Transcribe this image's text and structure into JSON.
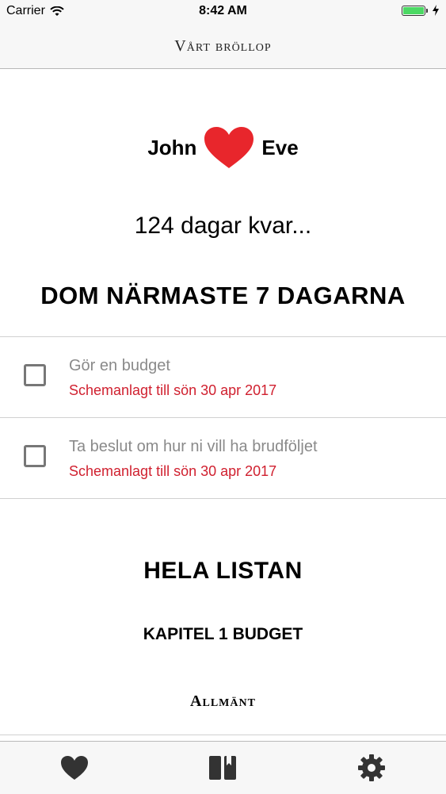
{
  "status_bar": {
    "carrier": "Carrier",
    "time": "8:42 AM"
  },
  "nav": {
    "title": "Vårt bröllop"
  },
  "couple": {
    "name1": "John",
    "name2": "Eve",
    "heart_color": "#e8262c"
  },
  "countdown": {
    "text": "124 dagar kvar..."
  },
  "upcoming": {
    "heading": "DOM NÄRMASTE 7 DAGARNA",
    "tasks": [
      {
        "title": "Gör en budget",
        "scheduled": "Schemanlagt till sön 30 apr 2017",
        "checked": false
      },
      {
        "title": "Ta beslut om hur ni vill ha brudföljet",
        "scheduled": "Schemanlagt till sön 30 apr 2017",
        "checked": false
      }
    ]
  },
  "full_list": {
    "heading": "HELA LISTAN",
    "chapter": "KAPITEL 1 BUDGET",
    "subchapter": "Allmänt"
  },
  "tab_bar": {
    "tabs": [
      "heart-icon",
      "book-icon",
      "gear-icon"
    ]
  },
  "colors": {
    "accent_red": "#d0202f",
    "battery_green": "#4cd964"
  }
}
